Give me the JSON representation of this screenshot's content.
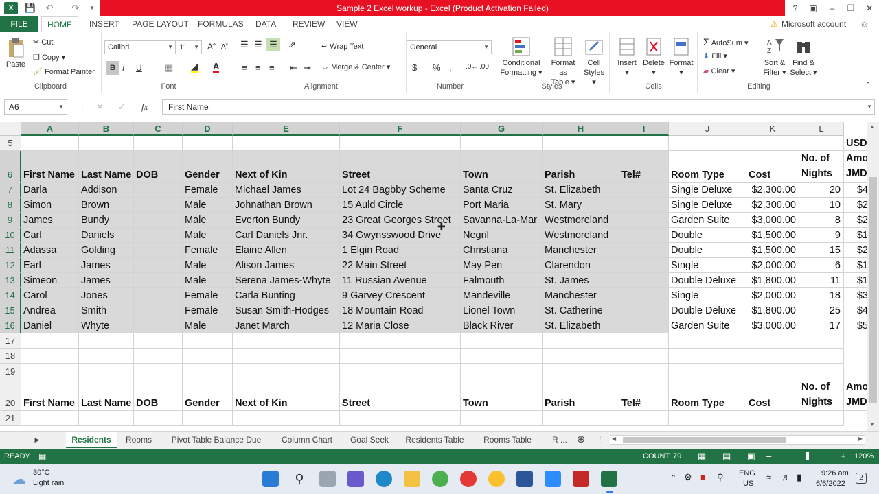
{
  "window": {
    "title": "Sample 2 Excel workup -  Excel (Product Activation Failed)",
    "help": "?",
    "colors": {
      "title_red": "#e81123",
      "excel_green": "#217346"
    }
  },
  "ribbon_tabs": [
    "FILE",
    "HOME",
    "INSERT",
    "PAGE LAYOUT",
    "FORMULAS",
    "DATA",
    "REVIEW",
    "VIEW"
  ],
  "account": "Microsoft account",
  "ribbon": {
    "clipboard": {
      "paste": "Paste",
      "cut": "Cut",
      "copy": "Copy",
      "format_painter": "Format Painter",
      "label": "Clipboard"
    },
    "font": {
      "name": "Calibri",
      "size": "11",
      "bold": "B",
      "italic": "I",
      "underline": "U",
      "label": "Font"
    },
    "alignment": {
      "wrap": "Wrap Text",
      "merge": "Merge & Center",
      "label": "Alignment"
    },
    "number": {
      "format": "General",
      "currency": "$",
      "percent": "%",
      "comma": ",",
      "label": "Number"
    },
    "styles": {
      "conditional": "Conditional",
      "conditional2": "Formatting",
      "format_as": "Format as",
      "format_as2": "Table",
      "cell": "Cell",
      "cell2": "Styles",
      "label": "Styles"
    },
    "cells": {
      "insert": "Insert",
      "delete": "Delete",
      "format": "Format",
      "label": "Cells"
    },
    "editing": {
      "autosum": "AutoSum",
      "fill": "Fill",
      "clear": "Clear",
      "sort": "Sort &",
      "sort2": "Filter",
      "find": "Find &",
      "find2": "Select",
      "label": "Editing"
    }
  },
  "formula_bar": {
    "name_box": "A6",
    "fx": "fx",
    "value": "First Name"
  },
  "columns": [
    "A",
    "B",
    "C",
    "D",
    "E",
    "F",
    "G",
    "H",
    "I",
    "J",
    "K",
    "L"
  ],
  "rows": [
    "5",
    "6",
    "7",
    "8",
    "9",
    "10",
    "11",
    "12",
    "13",
    "14",
    "15",
    "16",
    "17",
    "18",
    "19",
    "20",
    "21"
  ],
  "header_row": {
    "first": "First Name",
    "last": "Last Name",
    "dob": "DOB",
    "gender": "Gender",
    "kin": "Next of Kin",
    "street": "Street",
    "town": "Town",
    "parish": "Parish",
    "tel": "Tel#",
    "room": "Room Type",
    "cost": "Cost",
    "nights1": "No. of",
    "nights2": "Nights",
    "amt1": "Amo",
    "amt2": "JMD"
  },
  "usd_label": "USD",
  "records": [
    [
      "Darla",
      "Addison",
      "",
      "Female",
      "Michael James",
      "Lot 24 Bagbby Scheme",
      "Santa Cruz",
      "St. Elizabeth",
      "",
      "Single Deluxe",
      "$2,300.00",
      "20",
      "$4"
    ],
    [
      "Simon",
      "Brown",
      "",
      "Male",
      "Johnathan Brown",
      "15 Auld Circle",
      "Port Maria",
      "St. Mary",
      "",
      "Single Deluxe",
      "$2,300.00",
      "10",
      "$2"
    ],
    [
      "James",
      "Bundy",
      "",
      "Male",
      "Everton Bundy",
      "23 Great Georges Street",
      "Savanna-La-Mar",
      "Westmoreland",
      "",
      "Garden Suite",
      "$3,000.00",
      "8",
      "$2"
    ],
    [
      "Carl",
      "Daniels",
      "",
      "Male",
      "Carl Daniels Jnr.",
      "34 Gwynsswood Drive",
      "Negril",
      "Westmoreland",
      "",
      "Double",
      "$1,500.00",
      "9",
      "$1"
    ],
    [
      "Adassa",
      "Golding",
      "",
      "Female",
      "Elaine Allen",
      "1 Elgin Road",
      "Christiana",
      "Manchester",
      "",
      "Double",
      "$1,500.00",
      "15",
      "$2"
    ],
    [
      "Earl",
      "James",
      "",
      "Male",
      "Alison James",
      "22 Main Street",
      "May Pen",
      "Clarendon",
      "",
      "Single",
      "$2,000.00",
      "6",
      "$1"
    ],
    [
      "Simeon",
      "James",
      "",
      "Male",
      "Serena James-Whyte",
      "11 Russian Avenue",
      "Falmouth",
      "St. James",
      "",
      "Double Deluxe",
      "$1,800.00",
      "11",
      "$1"
    ],
    [
      "Carol",
      "Jones",
      "",
      "Female",
      "Carla Bunting",
      "9 Garvey Crescent",
      "Mandeville",
      "Manchester",
      "",
      "Single",
      "$2,000.00",
      "18",
      "$3"
    ],
    [
      "Andrea",
      "Smith",
      "",
      "Female",
      "Susan Smith-Hodges",
      "18 Mountain Road",
      "Lionel Town",
      "St. Catherine",
      "",
      "Double Deluxe",
      "$1,800.00",
      "25",
      "$4"
    ],
    [
      "Daniel",
      "Whyte",
      "",
      "Male",
      "Janet March",
      "12 Maria Close",
      "Black River",
      "St. Elizabeth",
      "",
      "Garden Suite",
      "$3,000.00",
      "17",
      "$5"
    ]
  ],
  "sheet_tabs": [
    "Residents",
    "Rooms",
    "Pivot Table Balance Due",
    "Column Chart",
    "Goal Seek",
    "Residents Table",
    "Rooms Table",
    "R ..."
  ],
  "status": {
    "ready": "READY",
    "count": "COUNT: 79",
    "zoom": "120%"
  },
  "taskbar": {
    "temp": "30°C",
    "weather": "Light rain",
    "lang1": "ENG",
    "lang2": "US",
    "time": "9:26 am",
    "date": "6/6/2022",
    "notif": "2"
  }
}
